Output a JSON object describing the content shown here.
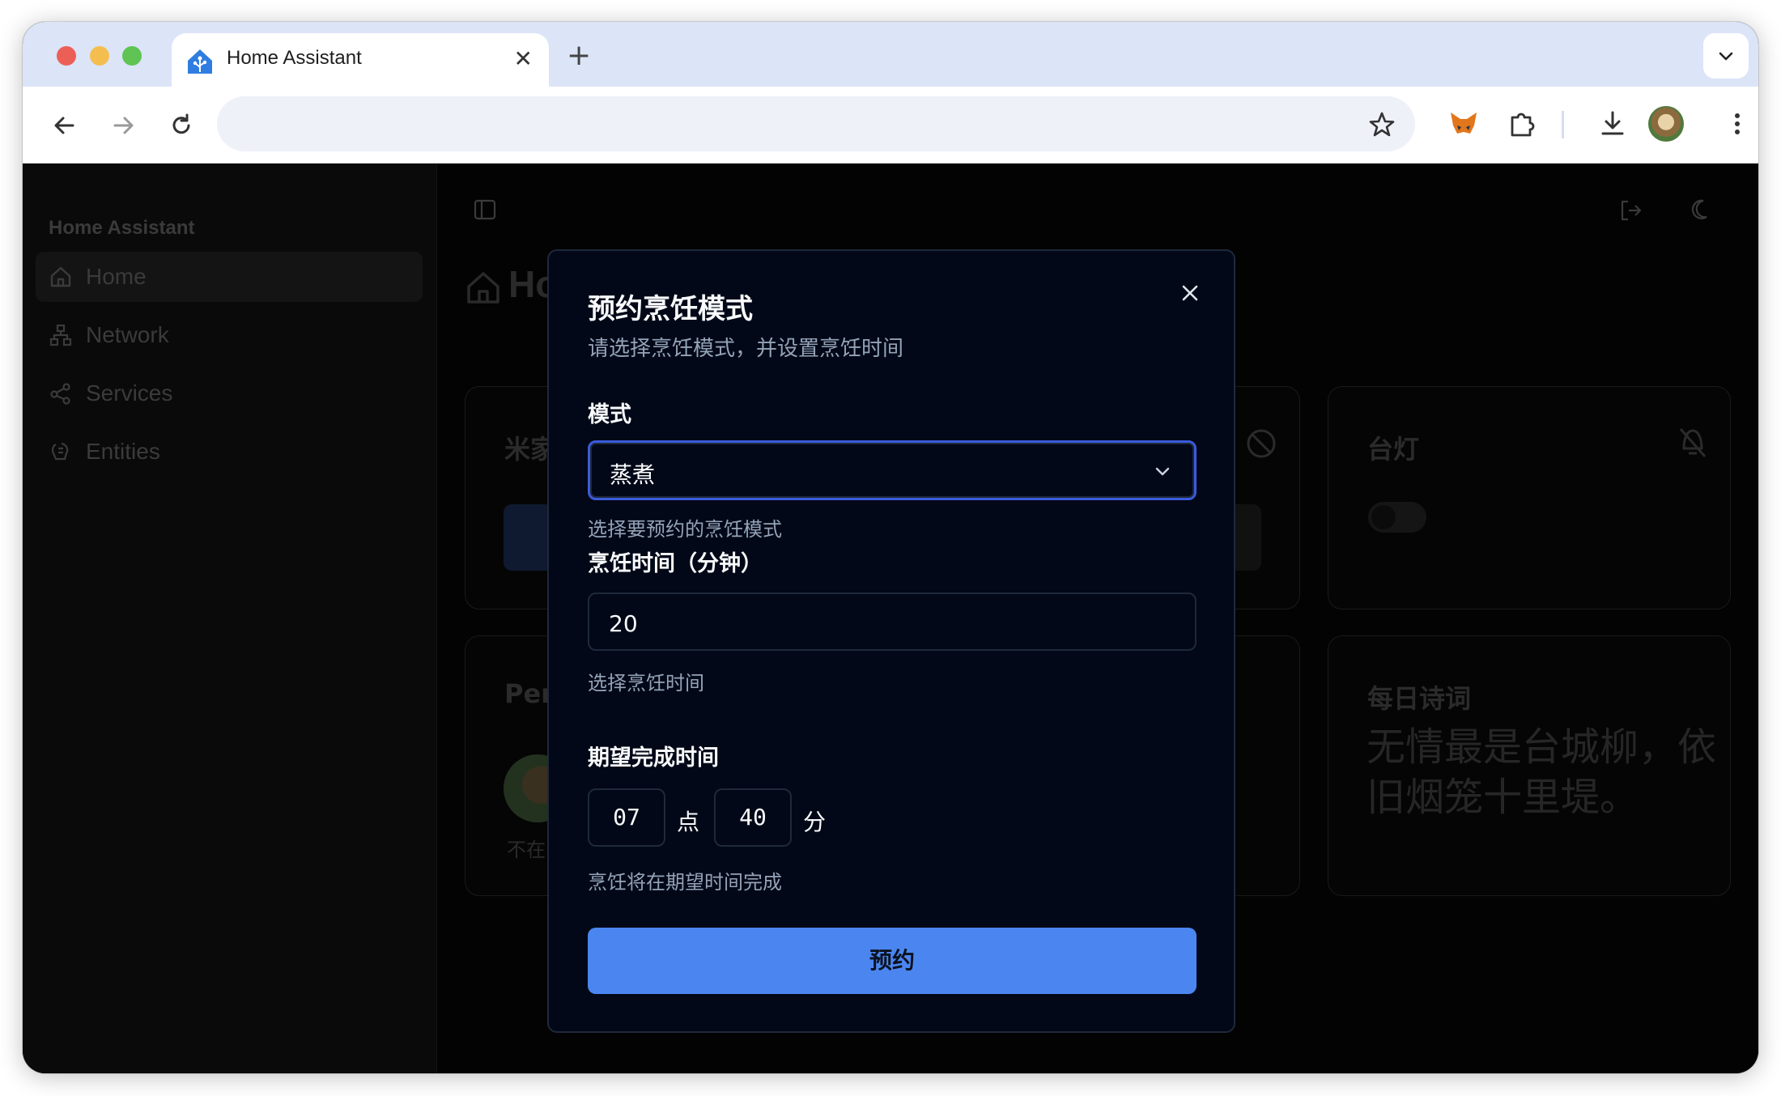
{
  "browser": {
    "tab_title": "Home Assistant",
    "tab_close": "✕",
    "new_tab": "+"
  },
  "sidebar": {
    "title": "Home Assistant",
    "items": [
      {
        "label": "Home",
        "icon": "home-icon",
        "active": true
      },
      {
        "label": "Network",
        "icon": "network-icon",
        "active": false
      },
      {
        "label": "Services",
        "icon": "services-icon",
        "active": false
      },
      {
        "label": "Entities",
        "icon": "entities-icon",
        "active": false
      }
    ]
  },
  "main": {
    "title": "Home",
    "cards": {
      "xiaomi_title": "米家",
      "lamp_title": "台灯",
      "person_title": "Persons",
      "person_status": "不在家",
      "poem_title": "每日诗词",
      "poem_text": "无情最是台城柳，依旧烟笼十里堤。"
    }
  },
  "modal": {
    "title": "预约烹饪模式",
    "subtitle": "请选择烹饪模式，并设置烹饪时间",
    "mode_label": "模式",
    "mode_value": "蒸煮",
    "mode_help": "选择要预约的烹饪模式",
    "time_label": "烹饪时间（分钟）",
    "time_value": "20",
    "time_help": "选择烹饪时间",
    "finish_label": "期望完成时间",
    "hour_value": "07",
    "hour_unit": "点",
    "minute_value": "40",
    "minute_unit": "分",
    "finish_help": "烹饪将在期望时间完成",
    "submit_label": "预约"
  },
  "colors": {
    "accent": "#4b86f0",
    "modal_bg": "#020817",
    "select_border": "#3b5bdb"
  }
}
